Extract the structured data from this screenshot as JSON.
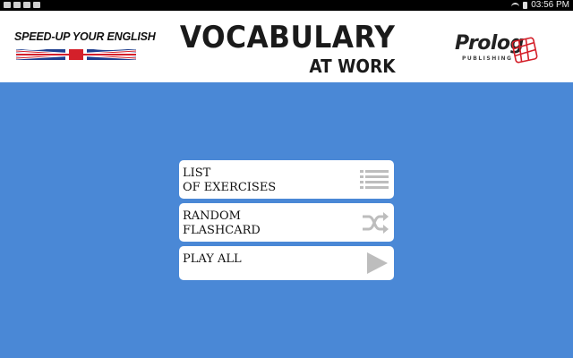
{
  "status_bar": {
    "time": "03:56 PM",
    "notification_icons": [
      "mail-icon",
      "mail-icon",
      "image-icon",
      "download-icon"
    ],
    "system_icons": [
      "wifi-icon",
      "battery-icon"
    ]
  },
  "header": {
    "left_brand": "SPEED-UP YOUR ENGLISH",
    "title": "VOCABULARY",
    "subtitle": "AT WORK",
    "right_brand": "Prolog",
    "right_brand_sub": "PUBLISHING"
  },
  "menu": {
    "items": [
      {
        "label": "LIST\nOF EXERCISES",
        "icon": "list-icon"
      },
      {
        "label": "RANDOM\nFLASHCARD",
        "icon": "shuffle-icon"
      },
      {
        "label": "PLAY ALL",
        "icon": "play-icon"
      }
    ]
  },
  "colors": {
    "background": "#4a88d6",
    "button_bg": "#ffffff",
    "icon_gray": "#bdbdbd",
    "flag_blue": "#1f3f8f",
    "flag_red": "#d4202a"
  }
}
